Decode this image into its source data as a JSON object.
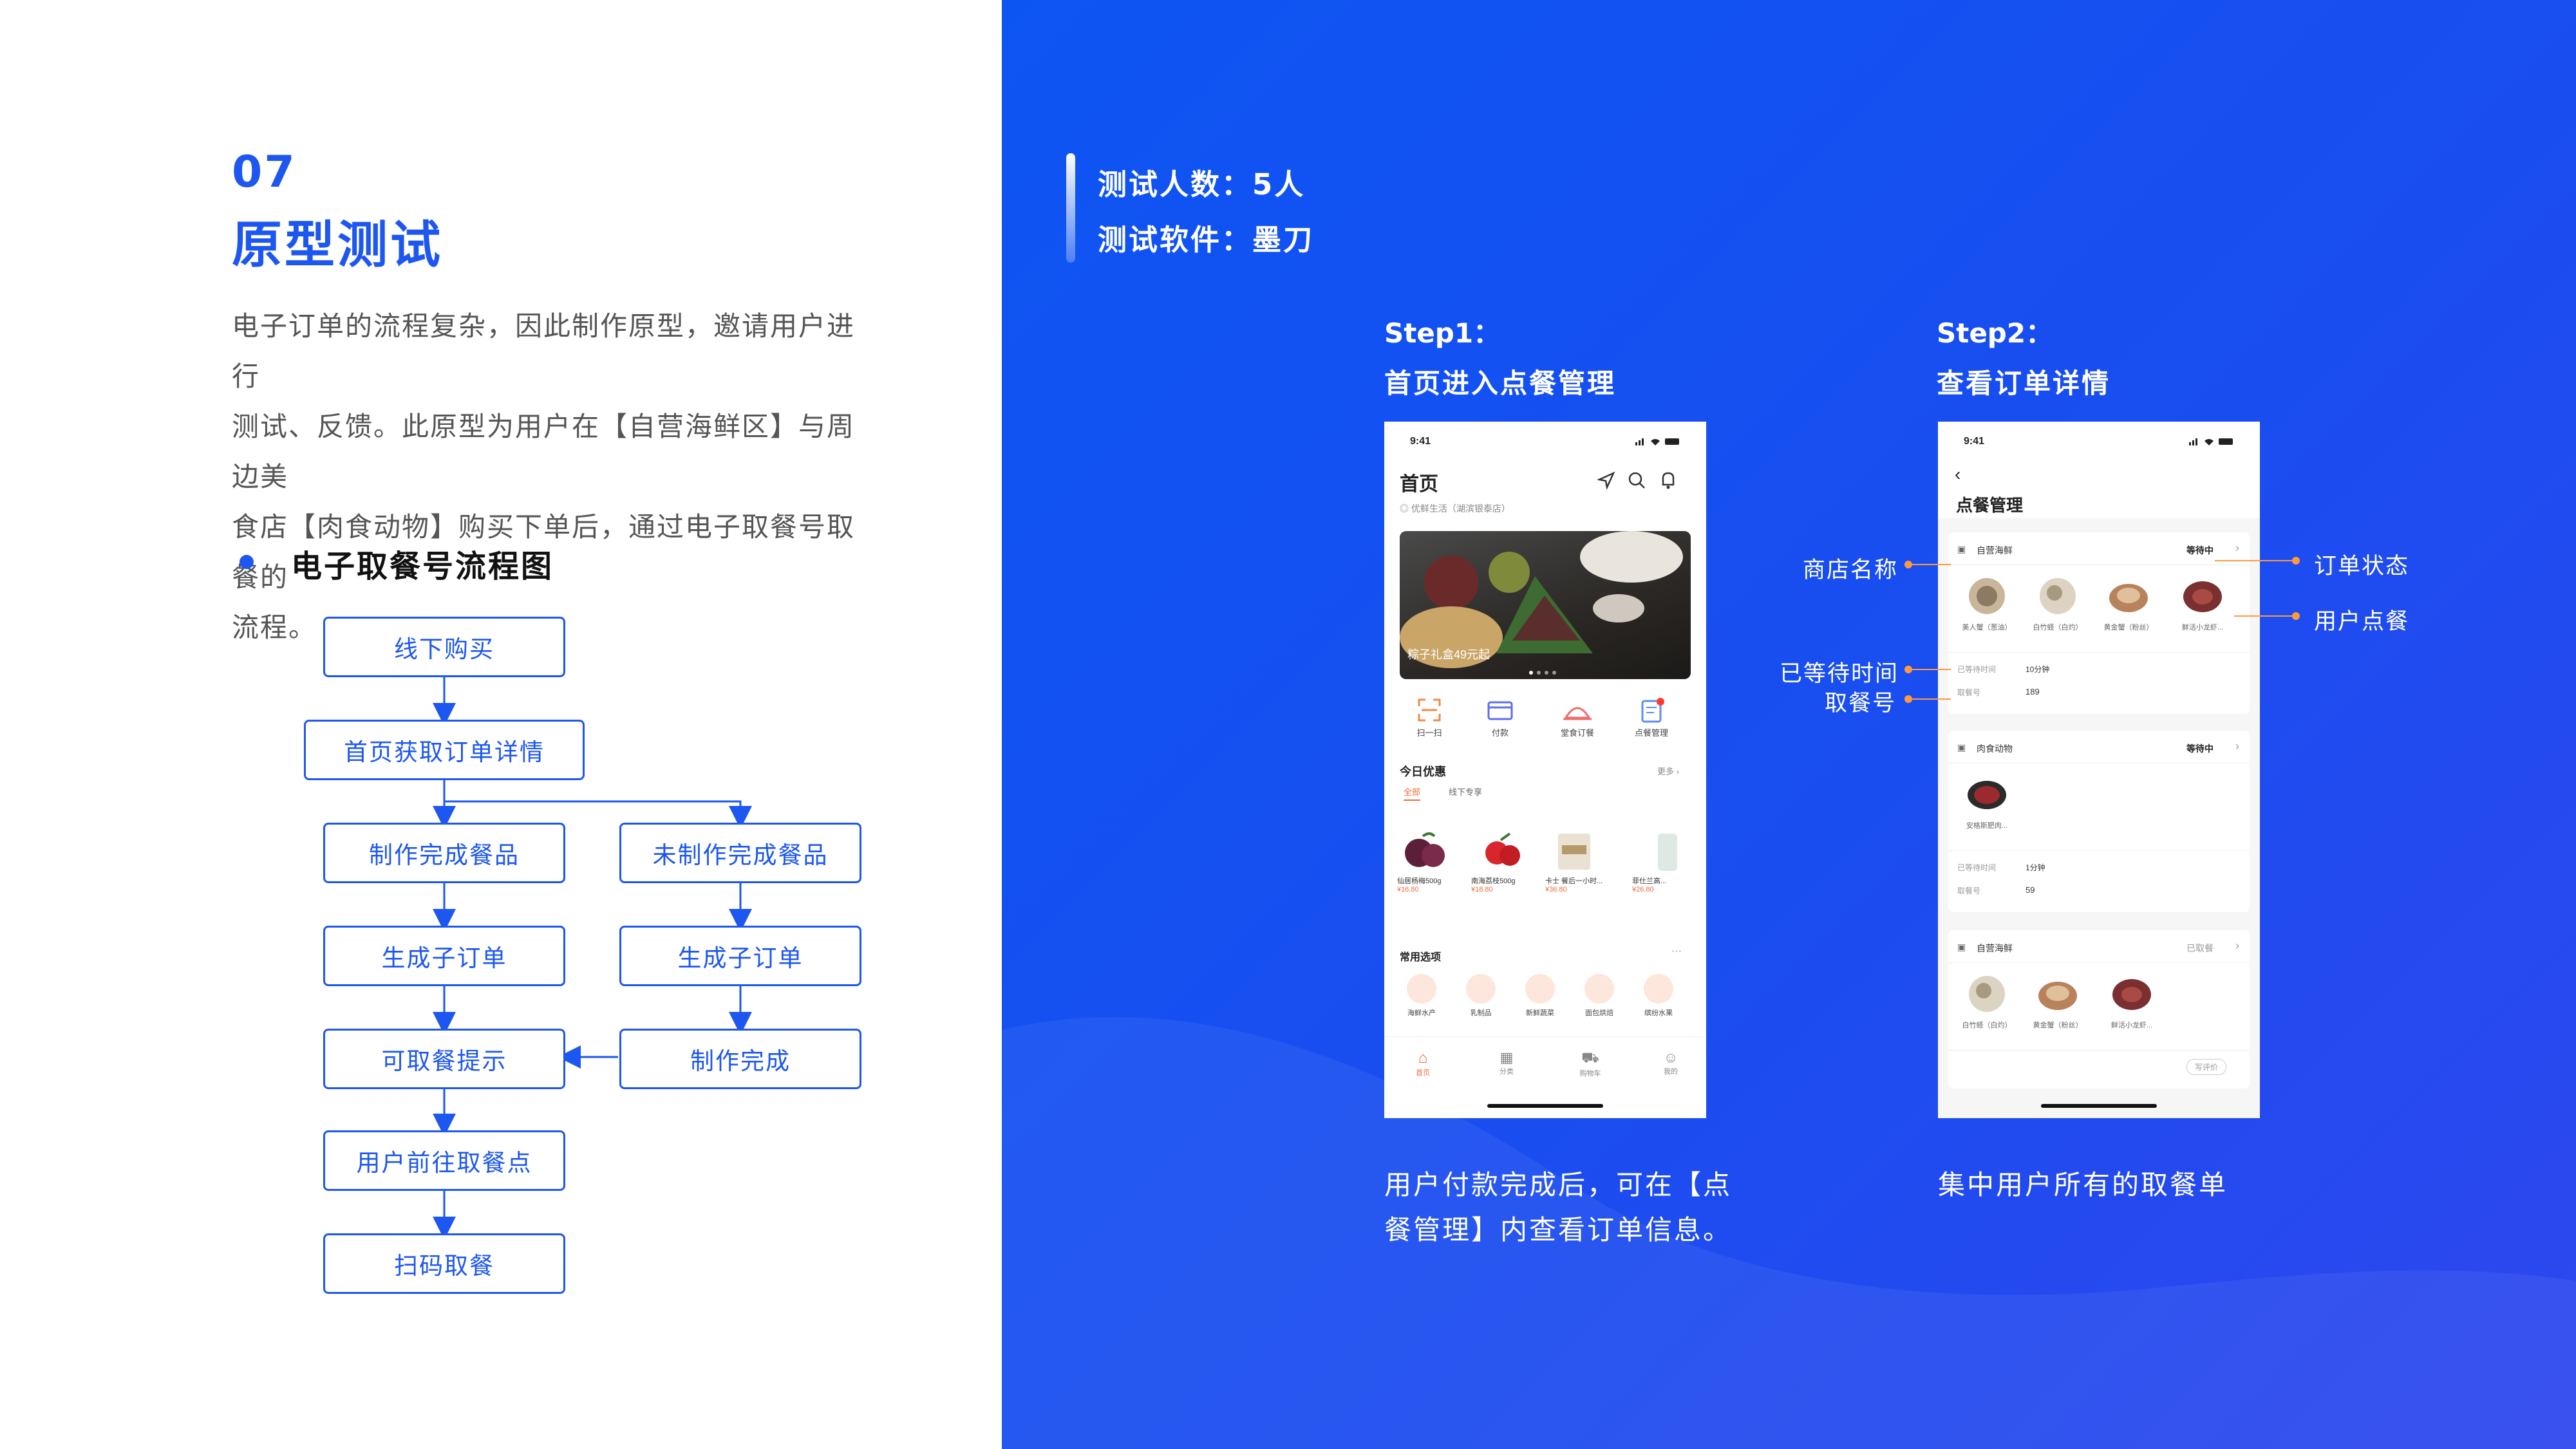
{
  "section": {
    "number": "07",
    "title": "原型测试"
  },
  "intro": {
    "lines": [
      "电子订单的流程复杂，因此制作原型，邀请用户进行",
      "测试、反馈。此原型为用户在【自营海鲜区】与周边美",
      "食店【肉食动物】购买下单后，通过电子取餐号取餐的",
      "流程。"
    ]
  },
  "flow": {
    "title": "电子取餐号流程图",
    "nodes": [
      "线下购买",
      "首页获取订单详情",
      "制作完成餐品",
      "未制作完成餐品",
      "生成子订单",
      "生成子订单",
      "可取餐提示",
      "制作完成",
      "用户前往取餐点",
      "扫码取餐"
    ]
  },
  "test": {
    "people": "测试人数：5人",
    "software": "测试软件：墨刀"
  },
  "step1": {
    "label": "Step1：",
    "title": "首页进入点餐管理",
    "caption": [
      "用户付款完成后，可在【点",
      "餐管理】内查看订单信息。"
    ]
  },
  "step2": {
    "label": "Step2：",
    "title": "查看订单详情",
    "caption": [
      "集中用户所有的取餐单"
    ]
  },
  "annotations": {
    "store_name": "商店名称",
    "wait_time": "已等待时间",
    "pickup_no": "取餐号",
    "order_status": "订单状态",
    "user_order": "用户点餐"
  },
  "phone1": {
    "time": "9:41",
    "title": "首页",
    "location": "优鲜生活（湖滨银泰店）",
    "banner": "粽子礼盒49元起",
    "quick": [
      "扫一扫",
      "付款",
      "堂食订餐",
      "点餐管理"
    ],
    "today_title": "今日优惠",
    "more": "更多",
    "tabs": [
      "全部",
      "线下专享"
    ],
    "products": [
      {
        "name": "仙居杨梅500g",
        "price": "¥16.80"
      },
      {
        "name": "南海荔枝500g",
        "price": "¥18.80"
      },
      {
        "name": "卡士 餐后一小时...",
        "price": "¥36.80"
      },
      {
        "name": "菲仕兰高...",
        "price": "¥26.80"
      }
    ],
    "common_title": "常用选项",
    "common": [
      "海鲜水产",
      "乳制品",
      "新鲜蔬菜",
      "面包烘焙",
      "缤纷水果"
    ],
    "nav": [
      "首页",
      "分类",
      "购物车",
      "我的"
    ],
    "colors": {
      "accent": "#f06a3b",
      "primary_text": "#222222"
    }
  },
  "phone2": {
    "time": "9:41",
    "title": "点餐管理",
    "orders": [
      {
        "store": "自营海鲜",
        "status": "等待中",
        "items": [
          "美人蟹（葱油）",
          "白竹蛏（白灼）",
          "黄金蟹（粉丝）",
          "鲜活小龙虾..."
        ],
        "wait_label": "已等待时间",
        "wait": "10分钟",
        "no_label": "取餐号",
        "no": "189"
      },
      {
        "store": "肉食动物",
        "status": "等待中",
        "items": [
          "安格斯肥肉..."
        ],
        "wait_label": "已等待时间",
        "wait": "1分钟",
        "no_label": "取餐号",
        "no": "59"
      },
      {
        "store": "自营海鲜",
        "status": "已取餐",
        "items": [
          "白竹蛏（白灼）",
          "黄金蟹（粉丝）",
          "鲜活小龙虾..."
        ],
        "action": "写评价"
      }
    ]
  },
  "colors": {
    "brand_blue": "#1d57f0",
    "annotation_orange": "#ff9a3c"
  }
}
